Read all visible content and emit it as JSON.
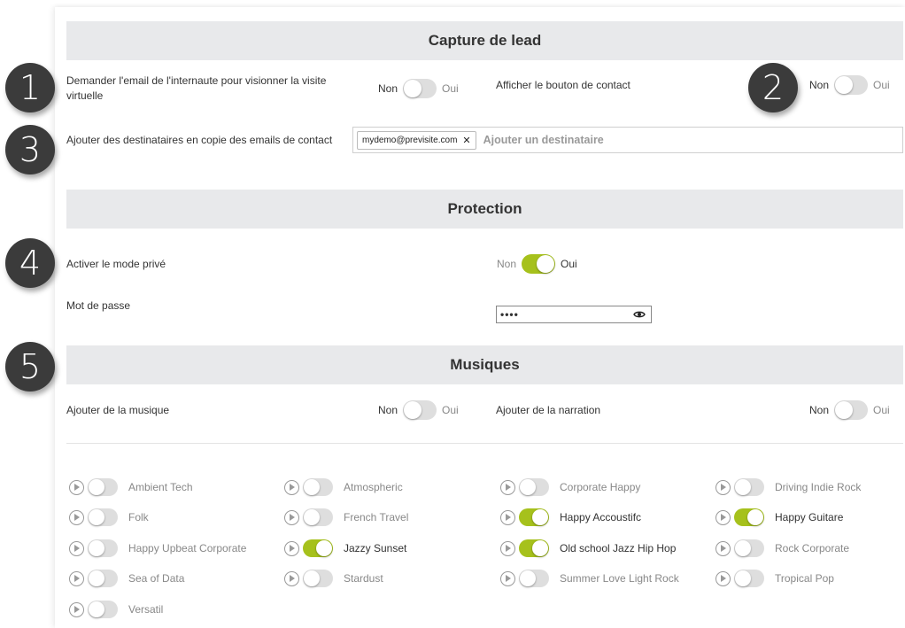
{
  "sections": {
    "lead": "Capture de lead",
    "protection": "Protection",
    "music": "Musiques"
  },
  "toggle_labels": {
    "off": "Non",
    "on": "Oui"
  },
  "lead": {
    "ask_email_label": "Demander l'email de l'internaute pour visionner la visite virtuelle",
    "ask_email_on": false,
    "contact_button_label": "Afficher le bouton de contact",
    "contact_button_on": false,
    "cc_label": "Ajouter des destinataires en copie des emails de contact",
    "cc_tags": [
      "mydemo@previsite.com"
    ],
    "cc_placeholder": "Ajouter un destinataire"
  },
  "protection": {
    "private_label": "Activer le mode privé",
    "private_on": true,
    "password_label": "Mot de passe",
    "password_mask": "••••"
  },
  "music": {
    "add_music_label": "Ajouter de la musique",
    "add_music_on": false,
    "add_narration_label": "Ajouter de la narration",
    "add_narration_on": false,
    "tracks": [
      {
        "name": "Ambient Tech",
        "on": false
      },
      {
        "name": "Atmospheric",
        "on": false
      },
      {
        "name": "Corporate Happy",
        "on": false
      },
      {
        "name": "Driving Indie Rock",
        "on": false
      },
      {
        "name": "Folk",
        "on": false
      },
      {
        "name": "French Travel",
        "on": false
      },
      {
        "name": "Happy Accoustifc",
        "on": true
      },
      {
        "name": "Happy Guitare",
        "on": true
      },
      {
        "name": "Happy Upbeat Corporate",
        "on": false
      },
      {
        "name": "Jazzy Sunset",
        "on": true
      },
      {
        "name": "Old school Jazz Hip Hop",
        "on": true
      },
      {
        "name": "Rock Corporate",
        "on": false
      },
      {
        "name": "Sea of Data",
        "on": false
      },
      {
        "name": "Stardust",
        "on": false
      },
      {
        "name": "Summer Love Light Rock",
        "on": false
      },
      {
        "name": "Tropical Pop",
        "on": false
      },
      {
        "name": "Versatil",
        "on": false
      }
    ]
  },
  "badges": [
    "1",
    "2",
    "3",
    "4",
    "5"
  ],
  "colors": {
    "accent": "#a6c11c",
    "header_bg": "#e8e9eb",
    "badge": "#3b3b3b"
  },
  "icons": {
    "play": "play-circle-icon",
    "eye": "eye-icon",
    "remove": "close-icon"
  }
}
